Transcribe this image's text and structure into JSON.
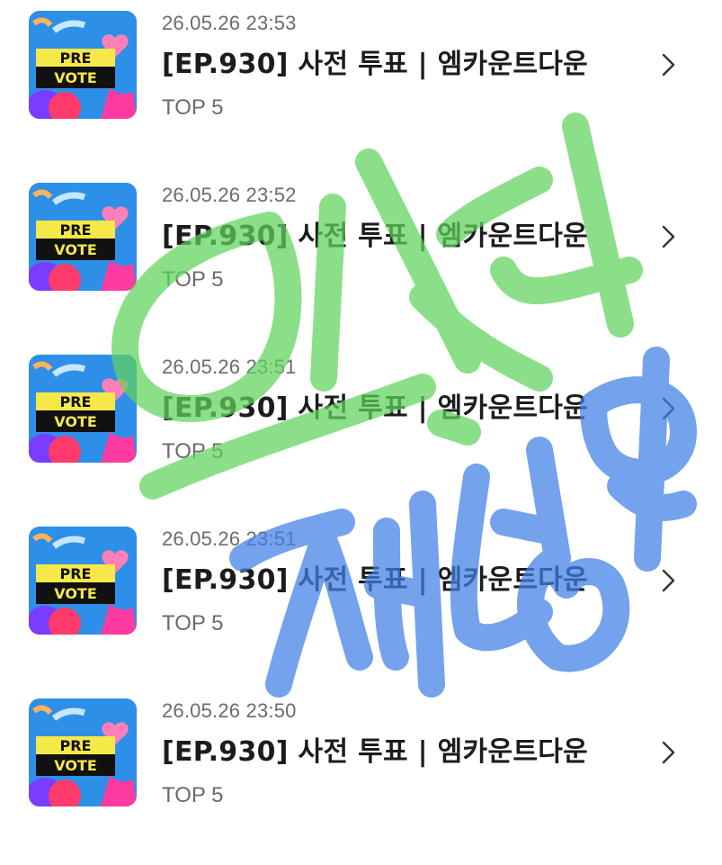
{
  "items": [
    {
      "timestamp": "26.05.26 23:53",
      "title": "[EP.930] 사전 투표 | 엠카운트다운",
      "subtitle": "TOP 5",
      "thumb_top": "PRE",
      "thumb_bottom": "VOTE"
    },
    {
      "timestamp": "26.05.26 23:52",
      "title": "[EP.930] 사전 투표 | 엠카운트다운",
      "subtitle": "TOP 5",
      "thumb_top": "PRE",
      "thumb_bottom": "VOTE"
    },
    {
      "timestamp": "26.05.26 23:51",
      "title": "[EP.930] 사전 투표 | 엠카운트다운",
      "subtitle": "TOP 5",
      "thumb_top": "PRE",
      "thumb_bottom": "VOTE"
    },
    {
      "timestamp": "26.05.26 23:51",
      "title": "[EP.930] 사전 투표 | 엠카운트다운",
      "subtitle": "TOP 5",
      "thumb_top": "PRE",
      "thumb_bottom": "VOTE"
    },
    {
      "timestamp": "26.05.26 23:50",
      "title": "[EP.930] 사전 투표 | 엠카운트다운",
      "subtitle": "TOP 5",
      "thumb_top": "PRE",
      "thumb_bottom": "VOTE"
    }
  ],
  "icons": {
    "thumbnail": "prevote-thumbnail-image",
    "chevron": "chevron-right-icon"
  },
  "overlay_colors": {
    "green": "#5fd35c",
    "blue": "#3f7fe6"
  },
  "colors": {
    "thumb_bg": "#2d8fe8",
    "thumb_banner": "#f7e84a",
    "thumb_heart": "#ff7fb8",
    "text_secondary": "#6b6b6b"
  }
}
